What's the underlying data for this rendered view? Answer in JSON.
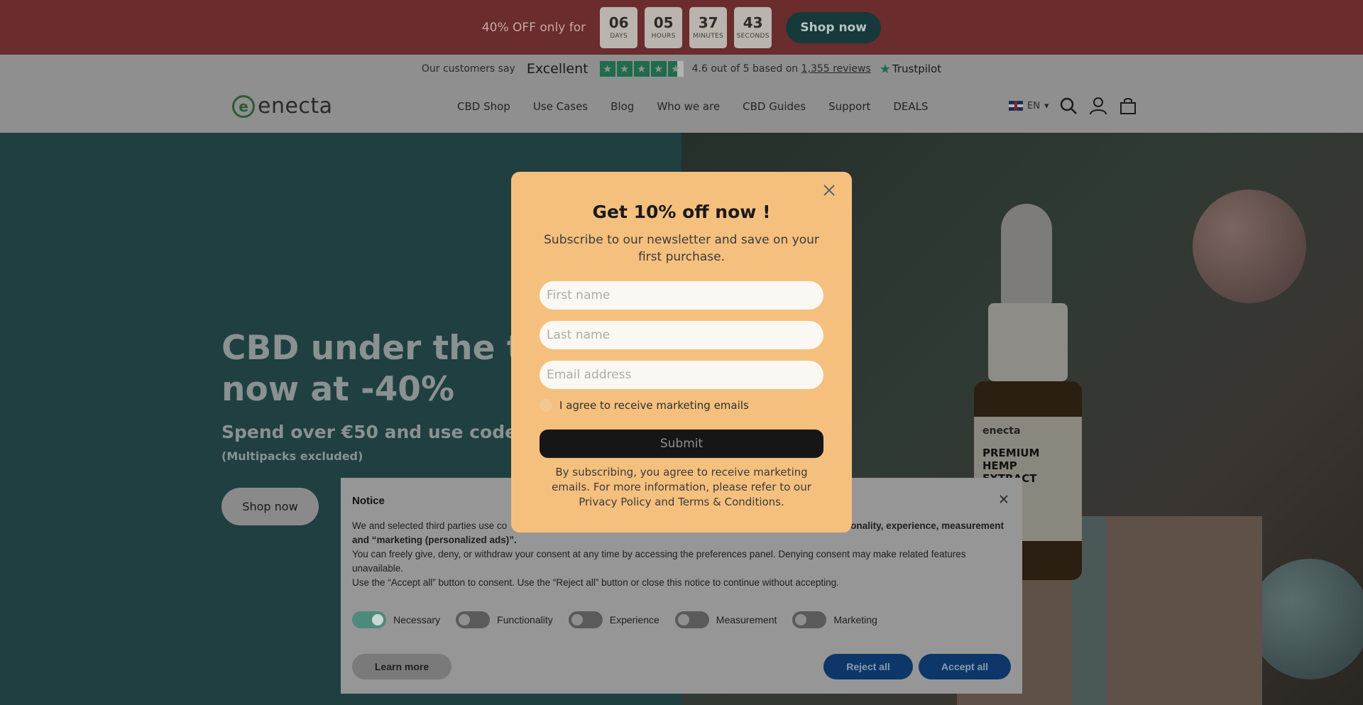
{
  "promo": {
    "text": "40% OFF only for",
    "countdown": [
      {
        "value": "06",
        "unit": "DAYS"
      },
      {
        "value": "05",
        "unit": "HOURS"
      },
      {
        "value": "37",
        "unit": "MINUTES"
      },
      {
        "value": "43",
        "unit": "SECONDS"
      }
    ],
    "button": "Shop now"
  },
  "trustpilot": {
    "prefix": "Our customers say",
    "rating_word": "Excellent",
    "score_text": "4.6 out of 5 based on",
    "reviews_link": "1,355 reviews",
    "brand": "Trustpilot",
    "stars": 4.6
  },
  "header": {
    "logo": "enecta",
    "nav": [
      "CBD Shop",
      "Use Cases",
      "Blog",
      "Who we are",
      "CBD Guides",
      "Support",
      "DEALS"
    ],
    "language": "EN"
  },
  "hero": {
    "title_line1": "CBD under the tre",
    "title_line2": "now at -40%",
    "subtitle": "Spend over €50 and use code XM",
    "note": "(Multipacks excluded)",
    "button": "Shop now",
    "bottle_brand": "enecta",
    "bottle_product": "PREMIUM HEMP EXTRACT"
  },
  "modal": {
    "title": "Get 10% off now !",
    "description": "Subscribe to our newsletter and save on your first purchase.",
    "first_name_placeholder": "First name",
    "last_name_placeholder": "Last name",
    "email_placeholder": "Email address",
    "agree_label": "I agree to receive marketing emails",
    "submit": "Submit",
    "legal": "By subscribing, you agree to receive marketing emails. For more information, please refer to our Privacy Policy and Terms & Conditions."
  },
  "cookie": {
    "title": "Notice",
    "para1_start": "We and selected third parties use co",
    "para1_end": "or functionality, experience, measurement and “marketing (personalized ads)”.",
    "para2": "You can freely give, deny, or withdraw your consent at any time by accessing the preferences panel. Denying consent may make related features unavailable.",
    "para3": "Use the “Accept all” button to consent. Use the “Reject all” button or close this notice to continue without accepting.",
    "toggles": [
      {
        "label": "Necessary",
        "on": true
      },
      {
        "label": "Functionality",
        "on": false
      },
      {
        "label": "Experience",
        "on": false
      },
      {
        "label": "Measurement",
        "on": false
      },
      {
        "label": "Marketing",
        "on": false
      }
    ],
    "learn_more": "Learn more",
    "reject_all": "Reject all",
    "accept_all": "Accept all"
  }
}
